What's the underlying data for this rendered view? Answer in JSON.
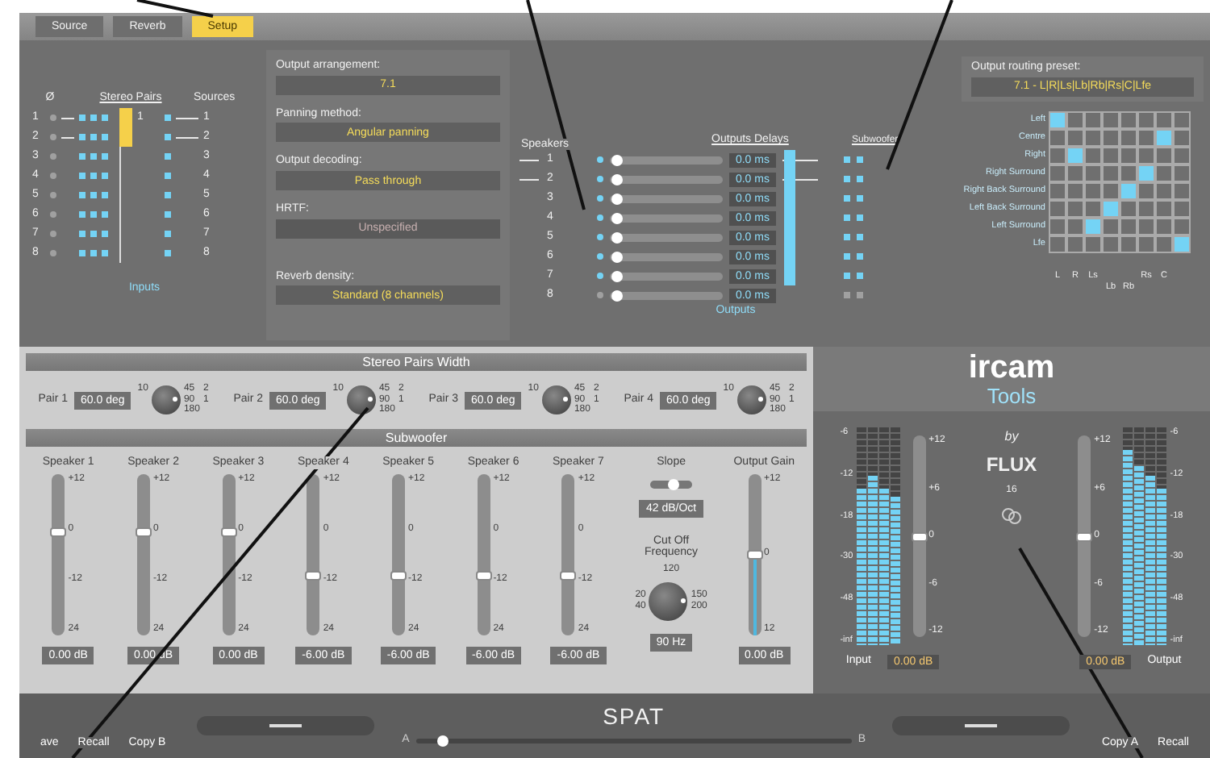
{
  "tabs": [
    {
      "label": "Source",
      "selected": false
    },
    {
      "label": "Reverb",
      "selected": false
    },
    {
      "label": "Setup",
      "selected": true
    }
  ],
  "inputs": {
    "headers": [
      "Ø",
      "Stereo Pairs",
      "Sources"
    ],
    "pair_label": "1",
    "title": "Inputs",
    "rows": [
      {
        "number": "1",
        "source": "1",
        "linked": true
      },
      {
        "number": "2",
        "source": "2",
        "linked": true
      },
      {
        "number": "3",
        "source": "3",
        "linked": false
      },
      {
        "number": "4",
        "source": "4",
        "linked": false
      },
      {
        "number": "5",
        "source": "5",
        "linked": false
      },
      {
        "number": "6",
        "source": "6",
        "linked": false
      },
      {
        "number": "7",
        "source": "7",
        "linked": false
      },
      {
        "number": "8",
        "source": "8",
        "linked": false
      }
    ]
  },
  "settings": [
    {
      "label": "Output arrangement:",
      "value": "7.1",
      "disabled": false
    },
    {
      "label": "Panning method:",
      "value": "Angular panning",
      "disabled": false
    },
    {
      "label": "Output decoding:",
      "value": "Pass through",
      "disabled": false
    },
    {
      "label": "HRTF:",
      "value": "Unspecified",
      "disabled": true
    },
    {
      "label": "Reverb density:",
      "value": "Standard (8 channels)",
      "disabled": false
    }
  ],
  "outputs": {
    "headers": [
      "Speakers",
      "Outputs Delays",
      "Subwoofer"
    ],
    "title": "Outputs",
    "rows": [
      {
        "number": "1",
        "delay": "0.0 ms",
        "level": 0.02,
        "active": true,
        "linked": true
      },
      {
        "number": "2",
        "delay": "0.0 ms",
        "level": 0.02,
        "active": true,
        "linked": true
      },
      {
        "number": "3",
        "delay": "0.0 ms",
        "level": 0.02,
        "active": true,
        "linked": false
      },
      {
        "number": "4",
        "delay": "0.0 ms",
        "level": 0.02,
        "active": true,
        "linked": false
      },
      {
        "number": "5",
        "delay": "0.0 ms",
        "level": 0.02,
        "active": true,
        "linked": false
      },
      {
        "number": "6",
        "delay": "0.0 ms",
        "level": 0.02,
        "active": true,
        "linked": false
      },
      {
        "number": "7",
        "delay": "0.0 ms",
        "level": 0.02,
        "active": true,
        "linked": false
      },
      {
        "number": "8",
        "delay": "0.0 ms",
        "level": 0.02,
        "active": false,
        "linked": false
      }
    ]
  },
  "routing": {
    "label": "Output routing preset:",
    "value": "7.1 - L|R|Ls|Lb|Rb|Rs|C|Lfe",
    "columns": [
      "L",
      "R",
      "Ls",
      "Lb",
      "Rb",
      "Rs",
      "C"
    ],
    "rows": [
      {
        "label": "Left",
        "cells": [
          true,
          false,
          false,
          false,
          false,
          false,
          false,
          false
        ]
      },
      {
        "label": "Centre",
        "cells": [
          false,
          false,
          false,
          false,
          false,
          false,
          true,
          false
        ]
      },
      {
        "label": "Right",
        "cells": [
          false,
          true,
          false,
          false,
          false,
          false,
          false,
          false
        ]
      },
      {
        "label": "Right Surround",
        "cells": [
          false,
          false,
          false,
          false,
          false,
          true,
          false,
          false
        ]
      },
      {
        "label": "Right Back Surround",
        "cells": [
          false,
          false,
          false,
          false,
          true,
          false,
          false,
          false
        ]
      },
      {
        "label": "Left Back Surround",
        "cells": [
          false,
          false,
          false,
          true,
          false,
          false,
          false,
          false
        ]
      },
      {
        "label": "Left Surround",
        "cells": [
          false,
          false,
          true,
          false,
          false,
          false,
          false,
          false
        ]
      },
      {
        "label": "Lfe",
        "cells": [
          false,
          false,
          false,
          false,
          false,
          false,
          false,
          true
        ]
      }
    ]
  },
  "stereo_width": {
    "title": "Stereo Pairs Width",
    "pairs": [
      {
        "label": "Pair 1",
        "value": "60.0 deg",
        "scale": [
          "10",
          "45",
          "2",
          "90",
          "1",
          "180"
        ]
      },
      {
        "label": "Pair 2",
        "value": "60.0 deg",
        "scale": [
          "10",
          "45",
          "2",
          "90",
          "1",
          "180"
        ]
      },
      {
        "label": "Pair 3",
        "value": "60.0 deg",
        "scale": [
          "10",
          "45",
          "2",
          "90",
          "1",
          "180"
        ]
      },
      {
        "label": "Pair 4",
        "value": "60.0 deg",
        "scale": [
          "10",
          "45",
          "2",
          "90",
          "1",
          "180"
        ]
      }
    ]
  },
  "subwoofer": {
    "title": "Subwoofer",
    "speakers": [
      {
        "name": "Speaker 1",
        "level": 0.64,
        "value": "0.00 dB",
        "scale": [
          "+12",
          "0",
          "-12",
          "24"
        ]
      },
      {
        "name": "Speaker 2",
        "level": 0.64,
        "value": "0.00 dB",
        "scale": [
          "+12",
          "0",
          "-12",
          "24"
        ]
      },
      {
        "name": "Speaker 3",
        "level": 0.64,
        "value": "0.00 dB",
        "scale": [
          "+12",
          "0",
          "-12",
          "24"
        ]
      },
      {
        "name": "Speaker 4",
        "level": 0.37,
        "value": "-6.00 dB",
        "scale": [
          "+12",
          "0",
          "-12",
          "24"
        ]
      },
      {
        "name": "Speaker 5",
        "level": 0.37,
        "value": "-6.00 dB",
        "scale": [
          "+12",
          "0",
          "-12",
          "24"
        ]
      },
      {
        "name": "Speaker 6",
        "level": 0.37,
        "value": "-6.00 dB",
        "scale": [
          "+12",
          "0",
          "-12",
          "24"
        ]
      },
      {
        "name": "Speaker 7",
        "level": 0.37,
        "value": "-6.00 dB",
        "scale": [
          "+12",
          "0",
          "-12",
          "24"
        ]
      }
    ],
    "slope": {
      "label": "Slope",
      "level": 0.6,
      "value": "42 dB/Oct"
    },
    "cutoff": {
      "label": "Cut Off Frequency",
      "value": "90 Hz",
      "scale": [
        "120",
        "20",
        "150",
        "40",
        "200"
      ]
    },
    "gain": {
      "label": "Output Gain",
      "level": 0.5,
      "value": "0.00 dB",
      "scale": [
        "+12",
        "0",
        "12"
      ]
    }
  },
  "brand": {
    "name": "ircam",
    "product": "Tools",
    "by": "by",
    "maker": "FLUX",
    "version": "16"
  },
  "meters": [
    {
      "label": "Input",
      "value": "0.00 dB",
      "gain": {
        "level": 0.5,
        "scale": [
          "+12",
          "+6",
          "0",
          "-6",
          "-12"
        ]
      },
      "scale": [
        "-6",
        "-12",
        "-18",
        "-30",
        "-48",
        "-inf"
      ],
      "channels": [
        {
          "level": 0.72
        },
        {
          "level": 0.78
        },
        {
          "level": 0.72
        },
        {
          "level": 0.68
        }
      ]
    },
    {
      "label": "Output",
      "value": "0.00 dB",
      "gain": {
        "level": 0.5,
        "scale": [
          "+12",
          "+6",
          "0",
          "-6",
          "-12"
        ]
      },
      "scale": [
        "-6",
        "-12",
        "-18",
        "-30",
        "-48",
        "-inf"
      ],
      "channels": [
        {
          "level": 0.9
        },
        {
          "level": 0.82
        },
        {
          "level": 0.78
        },
        {
          "level": 0.72
        }
      ]
    }
  ],
  "bottom": {
    "title": "SPAT",
    "left_buttons": [
      "ave",
      "Recall",
      "Copy B"
    ],
    "right_buttons": [
      "Copy A",
      "Recall"
    ],
    "ab": {
      "labels": [
        "A",
        "B"
      ],
      "level": 0.05
    }
  }
}
